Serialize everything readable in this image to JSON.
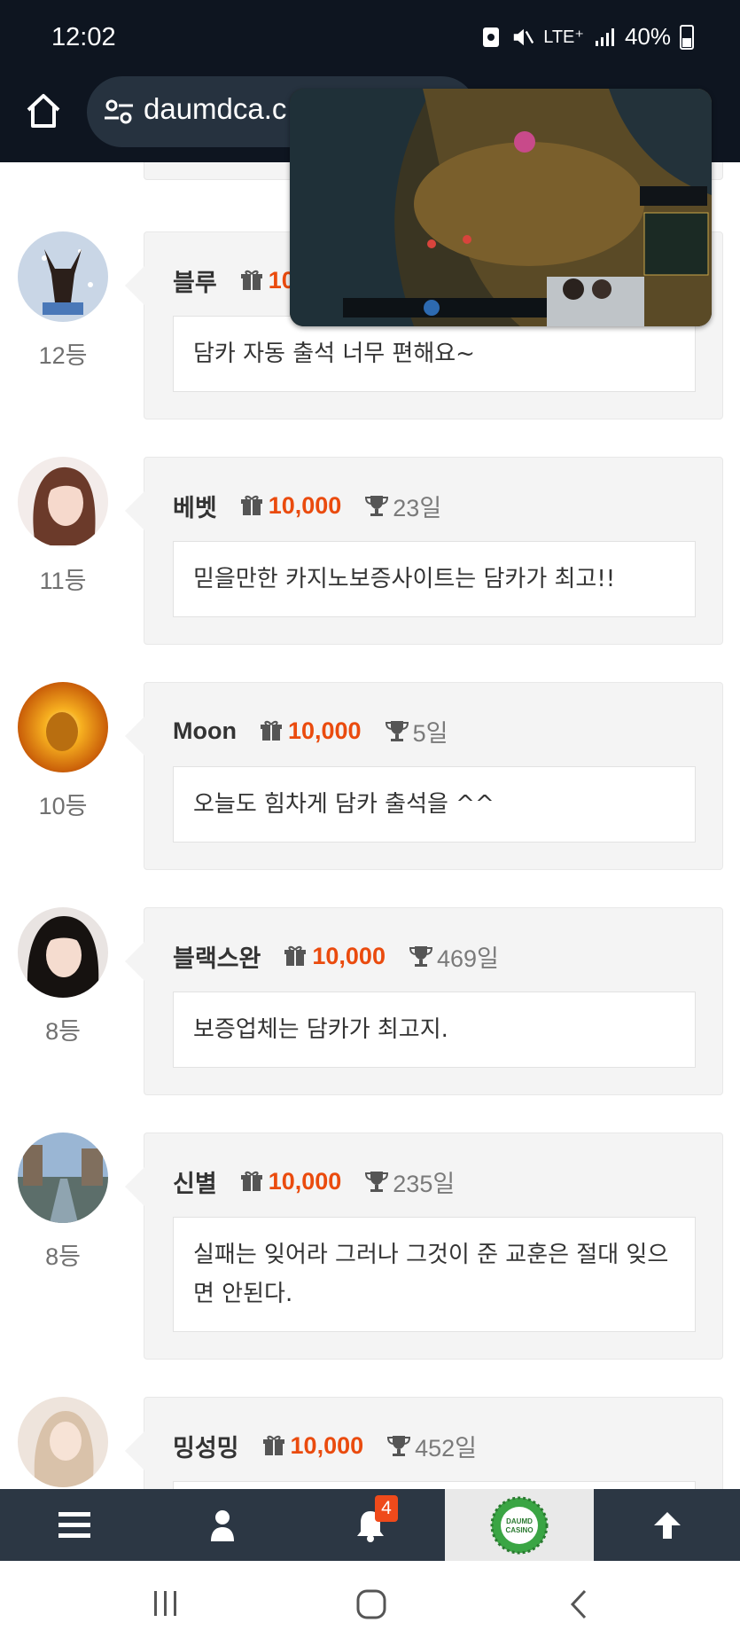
{
  "status": {
    "time": "12:02",
    "network": "LTE⁺",
    "battery": "40%"
  },
  "browser": {
    "url": "daumdca.c"
  },
  "entries": [
    {
      "name": "블루",
      "points": "10",
      "days": "",
      "message": "담카 자동 출석 너무 편해요~",
      "rank": "12등"
    },
    {
      "name": "베벳",
      "points": "10,000",
      "days": "23일",
      "message": "믿을만한 카지노보증사이트는 담카가 최고!!",
      "rank": "11등"
    },
    {
      "name": "Moon",
      "points": "10,000",
      "days": "5일",
      "message": "오늘도 힘차게 담카 출석을 ^^",
      "rank": "10등"
    },
    {
      "name": "블랙스완",
      "points": "10,000",
      "days": "469일",
      "message": "보증업체는 담카가 최고지.",
      "rank": "8등"
    },
    {
      "name": "신별",
      "points": "10,000",
      "days": "235일",
      "message": "실패는 잊어라 그러나 그것이 준 교훈은 절대 잊으면 안된다.",
      "rank": "8등"
    },
    {
      "name": "밍성밍",
      "points": "10,000",
      "days": "452일",
      "message": "",
      "rank": ""
    }
  ],
  "bottom_nav": {
    "notification_count": "4",
    "logo_text": "DAUMD CASINO"
  },
  "colors": {
    "point": "#ea4b0e",
    "nav_bg": "#2c3744",
    "topbar_bg": "#0e1520"
  },
  "icons": [
    "home-icon",
    "tune-icon",
    "gift-icon",
    "trophy-icon",
    "menu-icon",
    "user-icon",
    "bell-icon",
    "arrow-up-icon",
    "recents-icon",
    "home-circle-icon",
    "back-icon"
  ]
}
